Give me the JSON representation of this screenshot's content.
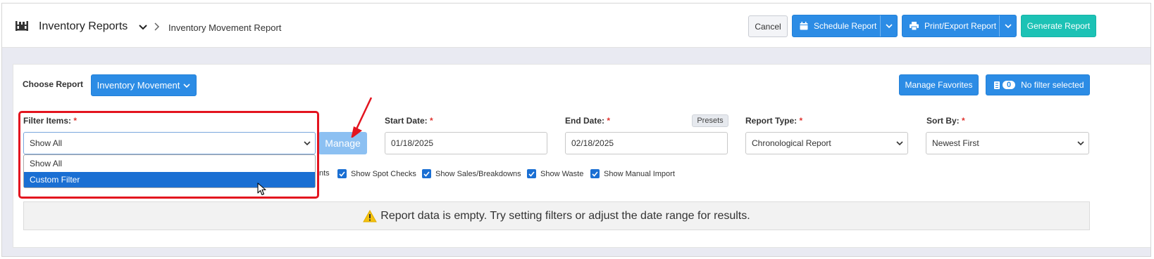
{
  "header": {
    "app_title": "Inventory Reports",
    "breadcrumb": "Inventory Movement Report",
    "cancel_label": "Cancel",
    "schedule_label": "Schedule Report",
    "print_label": "Print/Export Report",
    "generate_label": "Generate Report"
  },
  "toolbar": {
    "choose_report_label": "Choose Report",
    "report_select_label": "Inventory Movement",
    "manage_favorites_label": "Manage Favorites",
    "filter_count": "0",
    "no_filter_label": "No filter selected"
  },
  "filters": {
    "filter_items_label": "Filter Items:",
    "filter_items_value": "Show All",
    "manage_label": "Manage",
    "start_date_label": "Start Date:",
    "start_date_value": "01/18/2025",
    "end_date_label": "End Date:",
    "end_date_value": "02/18/2025",
    "presets_label": "Presets",
    "report_type_label": "Report Type:",
    "report_type_value": "Chronological Report",
    "sort_by_label": "Sort By:",
    "sort_by_value": "Newest First",
    "required_mark": "*"
  },
  "dropdown": {
    "options": [
      "Show All",
      "Custom Filter"
    ],
    "highlighted": "Custom Filter"
  },
  "checkboxes": {
    "partial_label": "nts",
    "items": [
      "Show Spot Checks",
      "Show Sales/Breakdowns",
      "Show Waste",
      "Show Manual Import"
    ]
  },
  "alert": {
    "message": "Report data is empty. Try setting filters or adjust the date range for results."
  },
  "colors": {
    "primary": "#2c8ce5",
    "teal": "#1cc2b5",
    "highlight_red": "#e3141f",
    "selected_option": "#1a6fd3"
  }
}
